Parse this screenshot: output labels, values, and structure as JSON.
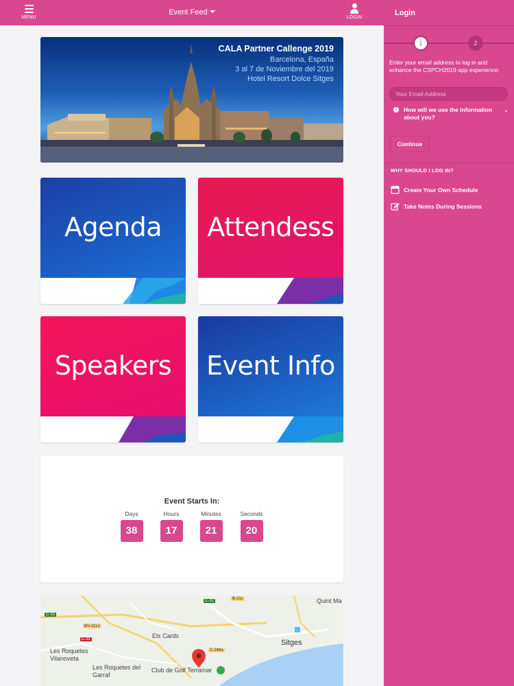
{
  "topbar": {
    "menu_label": "MENU",
    "title": "Event Feed",
    "login_label": "LOGIN"
  },
  "banner": {
    "line1": "CALA Partner Callenge 2019",
    "line2": "Barcelona, España",
    "line3": "3 al 7 de Noviembre del 2019",
    "line4": "Hotel Resort Dolce Sitges"
  },
  "tiles": [
    {
      "label": "Agenda"
    },
    {
      "label": "Attendess"
    },
    {
      "label": "Speakers"
    },
    {
      "label": "Event Info"
    }
  ],
  "countdown": {
    "title": "Event Starts In:",
    "units": [
      {
        "label": "Days",
        "value": "38"
      },
      {
        "label": "Hours",
        "value": "17"
      },
      {
        "label": "Minutes",
        "value": "21"
      },
      {
        "label": "Seconds",
        "value": "20"
      }
    ]
  },
  "map": {
    "places": [
      "Els Cards",
      "Les Roquetes Vilanoveta",
      "Les Roquetes del Garraf",
      "Club de Golf Terramar",
      "Sitges",
      "Quint Ma"
    ],
    "roads": [
      "C-15",
      "BV-2112",
      "C-31",
      "C-32",
      "B-211",
      "C-246a"
    ]
  },
  "panel": {
    "title": "Login",
    "step1": "1",
    "step2": "2",
    "intro": "Enter your email address to log in and enhance the CSPCH2019 app experience:",
    "email_placeholder": "Your Email Address",
    "how_use": "How will we use the information about you?",
    "continue_label": "Continue",
    "why_title": "WHY SHOULD I LOG IN?",
    "features": [
      "Create Your Own Schedule",
      "Take Notes During Sessions"
    ]
  },
  "colors": {
    "brand_pink": "#d9488e",
    "panel_dark": "#b43276"
  }
}
